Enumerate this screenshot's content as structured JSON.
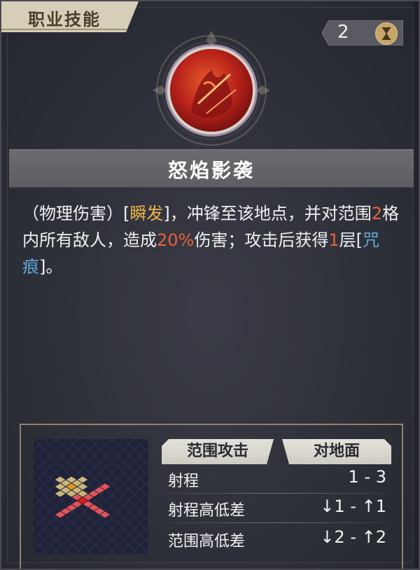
{
  "header": {
    "tab_label": "职业技能",
    "cost_value": "2",
    "cost_icon": "hourglass-icon"
  },
  "skill": {
    "icon": "flaming-warrior-skill-icon",
    "name": "怒焰影袭",
    "description": {
      "p1": "（物理伤害）[",
      "tag1": "瞬发",
      "p2": "]，冲锋至该地点，并对范围",
      "n1": "2",
      "p3": "格内所有敌人，造成",
      "pct": "20%",
      "p4": "伤害；攻击后获得",
      "n2": "1",
      "p5": "层[",
      "tag2": "咒痕",
      "p6": "]。"
    }
  },
  "info": {
    "tag_left": "范围攻击",
    "tag_right": "对地面",
    "stats": [
      {
        "label": "射程",
        "value": "1 - 3"
      },
      {
        "label": "射程高低差",
        "value": "↓1 - ↑1"
      },
      {
        "label": "范围高低差",
        "value": "↓2 - ↑2"
      }
    ]
  },
  "colors": {
    "gold": "#f0b64a",
    "orange": "#e8623a",
    "blue": "#5fa8d8",
    "tile_red": "#e0545a",
    "tile_yellow": "#cbb77a",
    "tile_center": "#e8961a"
  }
}
